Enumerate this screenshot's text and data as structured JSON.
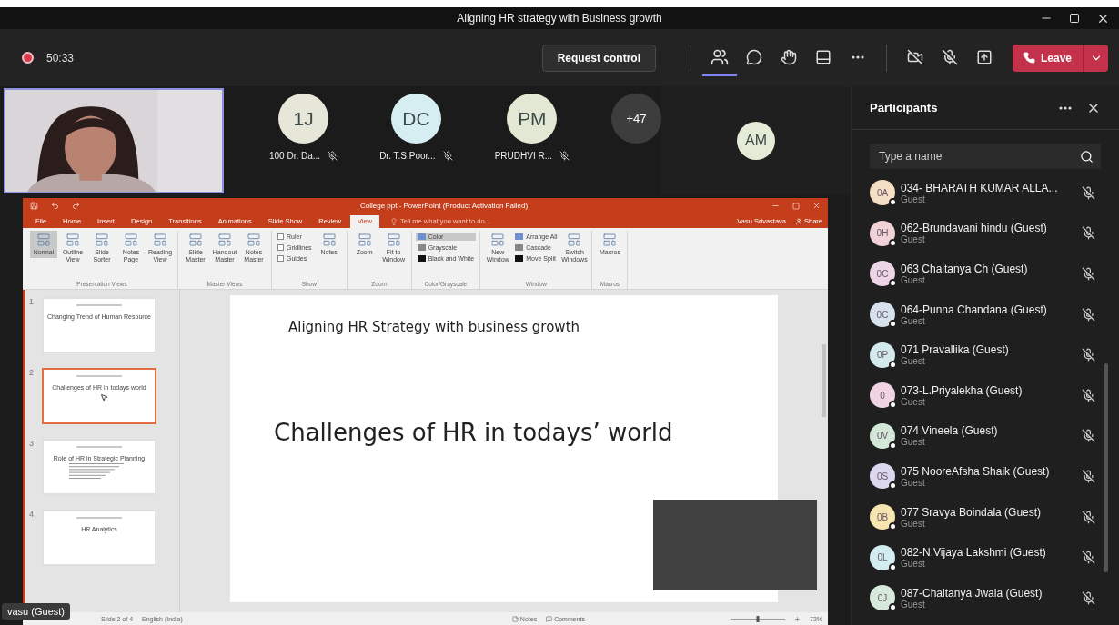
{
  "window": {
    "title": "Aligning HR strategy with Business growth"
  },
  "call_bar": {
    "timer": "50:33",
    "request_control": "Request control",
    "leave": "Leave",
    "toolbar": [
      {
        "kind": "people",
        "selected": true
      },
      {
        "kind": "chat",
        "selected": false
      },
      {
        "kind": "reactions",
        "selected": false
      },
      {
        "kind": "rooms",
        "selected": false
      },
      {
        "kind": "more",
        "selected": false
      }
    ],
    "devices": [
      {
        "kind": "camera",
        "on": false
      },
      {
        "kind": "mic",
        "on": false
      },
      {
        "kind": "share"
      }
    ]
  },
  "stage": {
    "tiles": [
      {
        "initials": "1J",
        "name": "100 Dr. Da...",
        "color": "#e6e7d8"
      },
      {
        "initials": "DC",
        "name": "Dr. T.S.Poor...",
        "color": "#d6eef2"
      },
      {
        "initials": "PM",
        "name": "PRUDHVI R...",
        "color": "#e2e8d3"
      }
    ],
    "overflow": "+47",
    "pinned": {
      "initials": "AM",
      "color": "#e4ecd8"
    },
    "presenter_label": "vasu (Guest)"
  },
  "powerpoint": {
    "title": "College ppt - PowerPoint (Product Activation Failed)",
    "tabs": [
      {
        "label": "File",
        "selected": false
      },
      {
        "label": "Home",
        "selected": false
      },
      {
        "label": "Insert",
        "selected": false
      },
      {
        "label": "Design",
        "selected": false
      },
      {
        "label": "Transitions",
        "selected": false
      },
      {
        "label": "Animations",
        "selected": false
      },
      {
        "label": "Slide Show",
        "selected": false
      },
      {
        "label": "Review",
        "selected": false
      },
      {
        "label": "View",
        "selected": true
      }
    ],
    "tell_me": "Tell me what you want to do...",
    "user": "Vasu Srivastava",
    "share": "Share",
    "groups": [
      {
        "label": "Presentation Views",
        "items": [
          {
            "kind": "large",
            "label": "Normal",
            "selected": true
          },
          {
            "kind": "large",
            "label": "Outline View",
            "selected": false
          },
          {
            "kind": "large",
            "label": "Slide Sorter",
            "selected": false
          },
          {
            "kind": "large",
            "label": "Notes Page",
            "selected": false
          },
          {
            "kind": "large",
            "label": "Reading View",
            "selected": false
          }
        ]
      },
      {
        "label": "Master Views",
        "items": [
          {
            "kind": "large",
            "label": "Slide Master",
            "selected": false
          },
          {
            "kind": "large",
            "label": "Handout Master",
            "selected": false
          },
          {
            "kind": "large",
            "label": "Notes Master",
            "selected": false
          }
        ]
      },
      {
        "label": "Show",
        "items": [
          {
            "kind": "check",
            "label": "Ruler",
            "checked": false
          },
          {
            "kind": "check",
            "label": "Gridlines",
            "checked": false
          },
          {
            "kind": "check",
            "label": "Guides",
            "checked": false
          },
          {
            "kind": "large",
            "label": "Notes",
            "selected": false
          }
        ]
      },
      {
        "label": "Zoom",
        "items": [
          {
            "kind": "large",
            "label": "Zoom",
            "selected": false
          },
          {
            "kind": "large",
            "label": "Fit to Window",
            "selected": false
          }
        ]
      },
      {
        "label": "Color/Grayscale",
        "items": [
          {
            "kind": "small",
            "label": "Color",
            "selected": true
          },
          {
            "kind": "small",
            "label": "Grayscale",
            "selected": false
          },
          {
            "kind": "small",
            "label": "Black and White",
            "selected": false
          }
        ]
      },
      {
        "label": "Window",
        "items": [
          {
            "kind": "large",
            "label": "New Window",
            "selected": false
          },
          {
            "kind": "small",
            "label": "Arrange All",
            "selected": false
          },
          {
            "kind": "small",
            "label": "Cascade",
            "selected": false
          },
          {
            "kind": "small",
            "label": "Move Split",
            "selected": false
          },
          {
            "kind": "large",
            "label": "Switch Windows",
            "selected": false
          }
        ]
      },
      {
        "label": "Macros",
        "items": [
          {
            "kind": "large",
            "label": "Macros",
            "selected": false
          }
        ]
      }
    ],
    "slides": [
      {
        "number": "1",
        "title": "Changing Trend of Human Resource",
        "kind": "title",
        "selected": false
      },
      {
        "number": "2",
        "title": "Challenges of HR in todays world",
        "kind": "title",
        "selected": true
      },
      {
        "number": "3",
        "title": "Role of HR in Strategic Planning",
        "kind": "bullets",
        "selected": false
      },
      {
        "number": "4",
        "title": "HR Analytics",
        "kind": "title",
        "selected": false
      }
    ],
    "current_slide": {
      "heading": "Aligning HR Strategy with business growth",
      "title": "Challenges of HR in todays’ world"
    },
    "status_bar": {
      "slide_count": "Slide 2 of 4",
      "language": "English (India)",
      "notes": "Notes",
      "comments": "Comments",
      "zoom": "73%",
      "level": 0.5
    }
  },
  "participants": {
    "title": "Participants",
    "search": {
      "placeholder": "Type a name"
    },
    "items": [
      {
        "initials": "0A",
        "name": "034- BHARATH KUMAR ALLA...",
        "role": "Guest",
        "color": "#f4dfc4"
      },
      {
        "initials": "0H",
        "name": "062-Brundavani hindu (Guest)",
        "role": "Guest",
        "color": "#f1d2d8"
      },
      {
        "initials": "0C",
        "name": "063 Chaitanya Ch (Guest)",
        "role": "Guest",
        "color": "#ecd5e4"
      },
      {
        "initials": "0C",
        "name": "064-Punna Chandana (Guest)",
        "role": "Guest",
        "color": "#d6e1ec"
      },
      {
        "initials": "0P",
        "name": "071 Pravallika (Guest)",
        "role": "Guest",
        "color": "#d4e9ec"
      },
      {
        "initials": "0",
        "name": "073-L.Priyalekha (Guest)",
        "role": "Guest",
        "color": "#f0d4e3"
      },
      {
        "initials": "0V",
        "name": "074 Vineela (Guest)",
        "role": "Guest",
        "color": "#d3e8d9"
      },
      {
        "initials": "0S",
        "name": "075 NooreAfsha Shaik (Guest)",
        "role": "Guest",
        "color": "#dbd7ef"
      },
      {
        "initials": "0B",
        "name": "077 Sravya Boindala (Guest)",
        "role": "Guest",
        "color": "#f6e5b0"
      },
      {
        "initials": "0L",
        "name": "082-N.Vijaya Lakshmi (Guest)",
        "role": "Guest",
        "color": "#d2ecef"
      },
      {
        "initials": "0J",
        "name": "087-Chaitanya Jwala (Guest)",
        "role": "Guest",
        "color": "#d6e9db"
      }
    ]
  }
}
